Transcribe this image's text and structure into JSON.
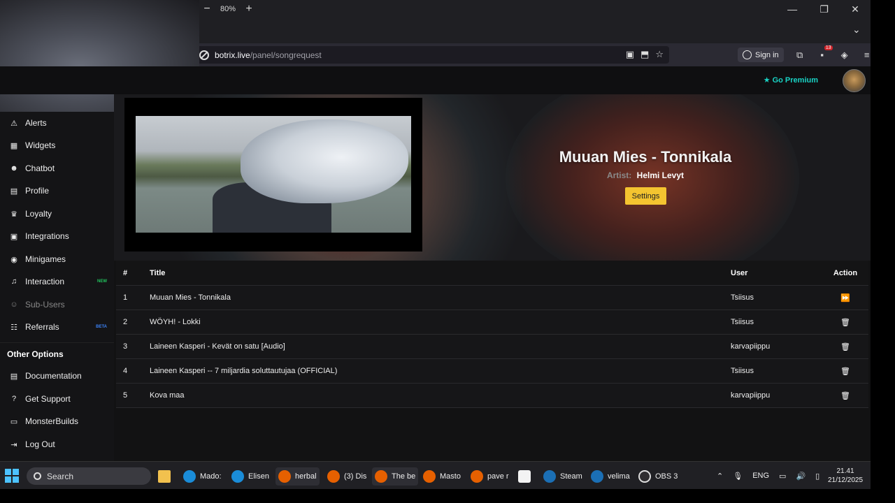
{
  "browser": {
    "zoom_minus": "−",
    "zoom_level": "80%",
    "zoom_plus": "+",
    "url_host": "botrix.live",
    "url_path": "/panel/songrequest",
    "sign_in": "Sign in",
    "ext_badge": "13"
  },
  "header": {
    "go_premium": "Go Premium"
  },
  "sidebar": {
    "items": [
      {
        "label": "Alerts",
        "icon": "⚠",
        "tag": ""
      },
      {
        "label": "Widgets",
        "icon": "▦",
        "tag": ""
      },
      {
        "label": "Chatbot",
        "icon": "☻",
        "tag": ""
      },
      {
        "label": "Profile",
        "icon": "▤",
        "tag": ""
      },
      {
        "label": "Loyalty",
        "icon": "♛",
        "tag": ""
      },
      {
        "label": "Integrations",
        "icon": "▣",
        "tag": ""
      },
      {
        "label": "Minigames",
        "icon": "◉",
        "tag": ""
      },
      {
        "label": "Interaction",
        "icon": "♫",
        "tag": "NEW"
      },
      {
        "label": "Sub-Users",
        "icon": "☺",
        "tag": ""
      },
      {
        "label": "Referrals",
        "icon": "☷",
        "tag": "BETA"
      }
    ],
    "other_heading": "Other Options",
    "other_items": [
      {
        "label": "Documentation",
        "icon": "▤"
      },
      {
        "label": "Get Support",
        "icon": "?"
      },
      {
        "label": "MonsterBuilds",
        "icon": "▭"
      },
      {
        "label": "Log Out",
        "icon": "⇥"
      }
    ],
    "colors": {
      "new_tag": "#22c55e",
      "beta_tag": "#3b82f6"
    }
  },
  "now_playing": {
    "title": "Muuan Mies - Tonnikala",
    "artist_label": "Artist:",
    "artist": "Helmi Levyt",
    "settings_button": "Settings"
  },
  "queue": {
    "headers": {
      "num": "#",
      "title": "Title",
      "user": "User",
      "action": "Action"
    },
    "rows": [
      {
        "num": "1",
        "title": "Muuan Mies - Tonnikala",
        "user": "Tsiisus",
        "action": "skip"
      },
      {
        "num": "2",
        "title": "WÖYH! - Lokki",
        "user": "Tsiisus",
        "action": "delete"
      },
      {
        "num": "3",
        "title": "Laineen Kasperi - Kevät on satu [Audio]",
        "user": "karvapiippu",
        "action": "delete"
      },
      {
        "num": "4",
        "title": "Laineen Kasperi -- 7 miljardia soluttautujaa (OFFICIAL)",
        "user": "Tsiisus",
        "action": "delete"
      },
      {
        "num": "5",
        "title": "Kova maa",
        "user": "karvapiippu",
        "action": "delete"
      }
    ]
  },
  "taskbar": {
    "search": "Search",
    "apps": [
      {
        "label": "Mado:",
        "color": "#1a8cd8"
      },
      {
        "label": "Elisen",
        "color": "#1a8cd8"
      },
      {
        "label": "herbal",
        "color": "#e66000"
      },
      {
        "label": "(3) Dis",
        "color": "#e66000"
      },
      {
        "label": "The be",
        "color": "#e66000"
      },
      {
        "label": "Masto",
        "color": "#e66000"
      },
      {
        "label": "pave r",
        "color": "#e66000"
      },
      {
        "label": "Steam",
        "color": "#1b6fb5"
      },
      {
        "label": "velima",
        "color": "#1b6fb5"
      },
      {
        "label": "OBS 3",
        "color": "#302e31"
      }
    ],
    "lang": "ENG",
    "time": "21.41",
    "date": "21/12/2025"
  }
}
